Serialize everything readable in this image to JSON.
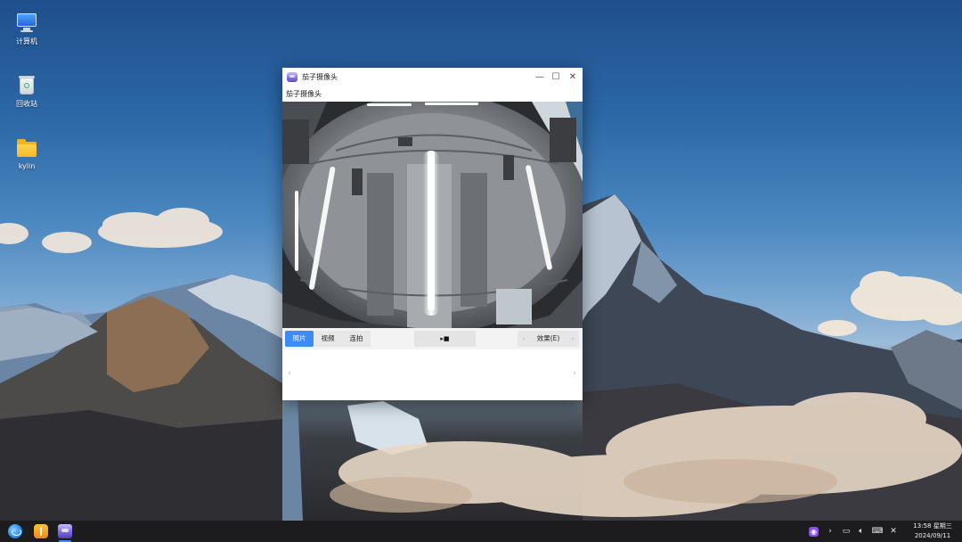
{
  "desktop": {
    "icons": [
      {
        "label": "计算机",
        "icon": "computer-icon"
      },
      {
        "label": "回收站",
        "icon": "trash-icon"
      },
      {
        "label": "kylin",
        "icon": "folder-icon"
      }
    ]
  },
  "window": {
    "title": "茄子摄像头",
    "subtitle": "茄子摄像头",
    "controls": {
      "minimize": "—",
      "maximize": "☐",
      "close": "✕"
    },
    "mode_tabs": [
      {
        "label": "照片",
        "active": true
      },
      {
        "label": "视频",
        "active": false
      },
      {
        "label": "连拍",
        "active": false
      }
    ],
    "shutter_label": "▸■",
    "effects": {
      "label": "效果(E)",
      "prev": "‹",
      "next": "›"
    },
    "thumbs": {
      "prev": "‹",
      "next": "›"
    }
  },
  "taskbar": {
    "apps": [
      "start-menu-icon",
      "software-store-icon",
      "cheese-camera-icon"
    ],
    "tray": [
      "camera-tray-icon",
      "expand-tray-icon",
      "notebook-icon",
      "volume-icon",
      "keyboard-icon",
      "network-icon"
    ],
    "time": "13:58 星期三",
    "date": "2024/09/11"
  },
  "colors": {
    "accent": "#3d8bf5",
    "taskbar": "#1c1c1e",
    "sky": "#2c67a6"
  }
}
